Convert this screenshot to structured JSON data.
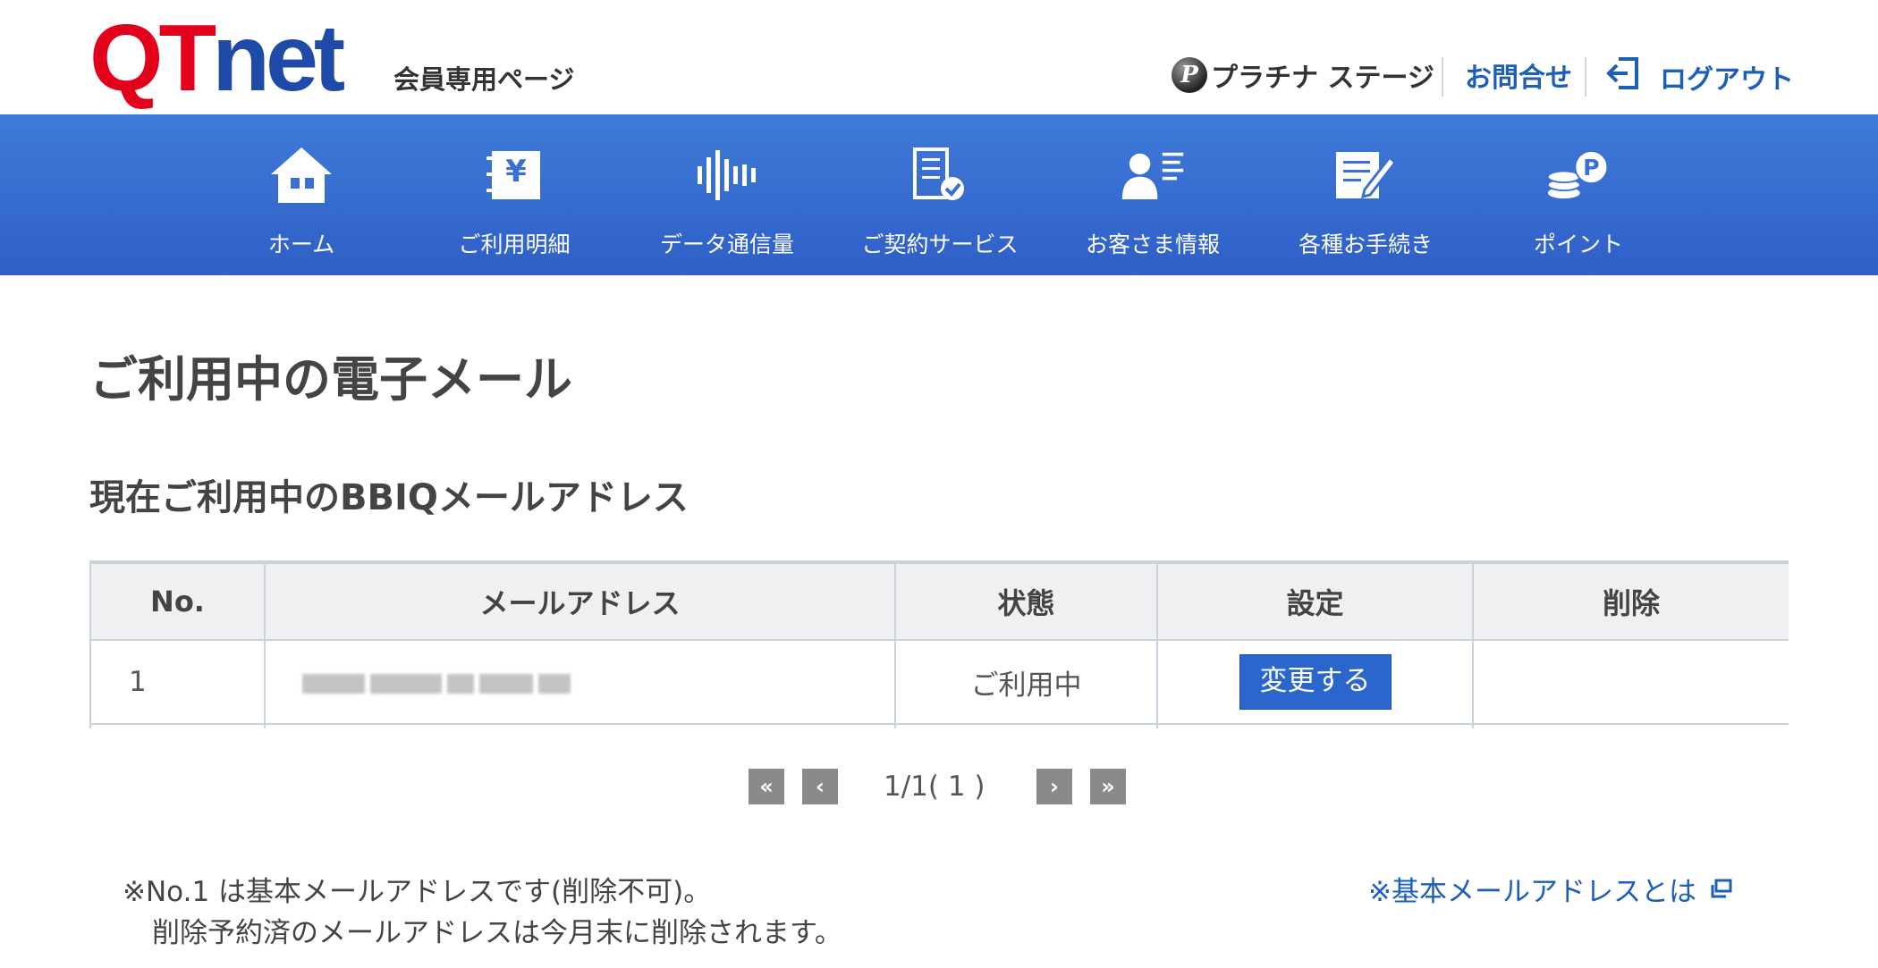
{
  "header": {
    "logo": {
      "q": "Q",
      "t": "T",
      "net": "net"
    },
    "member_label": "会員専用ページ",
    "stage_badge": "P",
    "stage_label": "プラチナ ステージ",
    "inquiry_label": "お問合せ",
    "logout_label": "ログアウト"
  },
  "nav": {
    "items": [
      {
        "label": "ホーム",
        "icon": "home-icon"
      },
      {
        "label": "ご利用明細",
        "icon": "yen-statement-icon"
      },
      {
        "label": "データ通信量",
        "icon": "sound-wave-icon"
      },
      {
        "label": "ご契約サービス",
        "icon": "contract-check-icon"
      },
      {
        "label": "お客さま情報",
        "icon": "customer-profile-icon"
      },
      {
        "label": "各種お手続き",
        "icon": "document-edit-icon"
      },
      {
        "label": "ポイント",
        "icon": "points-coins-icon"
      }
    ]
  },
  "main": {
    "page_title": "ご利用中の電子メール",
    "section_title": "現在ご利用中のBBIQメールアドレス",
    "table": {
      "headers": [
        "No.",
        "メールアドレス",
        "状態",
        "設定",
        "削除"
      ],
      "rows": [
        {
          "no": "1",
          "email": "",
          "status": "ご利用中",
          "action_label": "変更する",
          "delete": ""
        }
      ]
    },
    "pagination": {
      "first": "«",
      "prev": "‹",
      "text": "1/1( 1 )",
      "next": "›",
      "last": "»"
    },
    "notes": {
      "line1": "※No.1 は基本メールアドレスです(削除不可)。",
      "line2": "削除予約済のメールアドレスは今月末に削除されます。",
      "link": "※基本メールアドレスとは"
    }
  },
  "colors": {
    "brand_red": "#e2001a",
    "brand_blue": "#1f4aa8",
    "nav_bg": "#3f7bd8",
    "link": "#1d5fb8",
    "button": "#2b66cc"
  }
}
